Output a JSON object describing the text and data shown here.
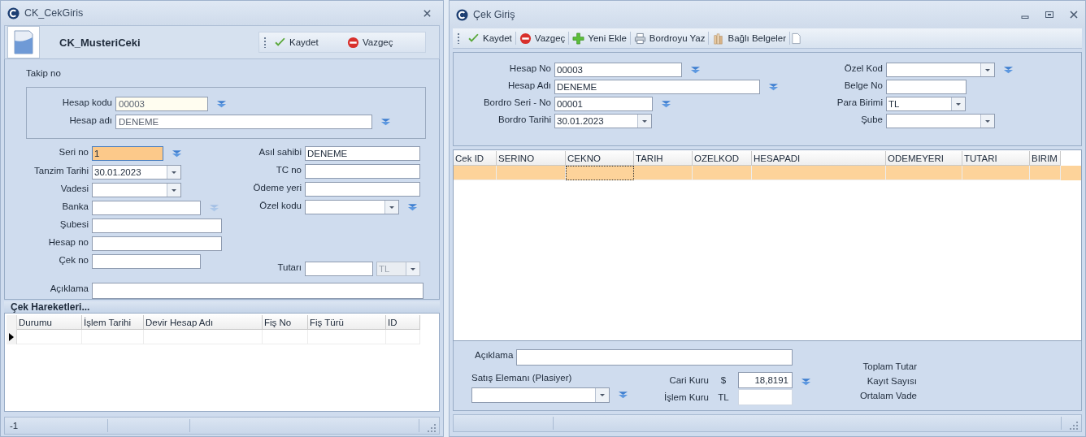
{
  "left_window": {
    "title": "CK_CekGiris",
    "header": {
      "title": "CK_MusteriCeki"
    },
    "buttons": [
      {
        "label": "Kaydet",
        "kind": "save"
      },
      {
        "label": "Vazgeç",
        "kind": "cancel"
      }
    ],
    "takip_no": {
      "label": "Takip no"
    },
    "account_fields": [
      {
        "label": "Hesap kodu",
        "value": "00003"
      },
      {
        "label": "Hesap adı",
        "value": "DENEME"
      }
    ],
    "left_fields": [
      {
        "label": "Seri no",
        "value": "1",
        "kind": "lookup",
        "focused": true,
        "lookup_disabled": false
      },
      {
        "label": "Tanzim Tarihi",
        "value": "30.01.2023",
        "kind": "combo",
        "focused": false
      },
      {
        "label": "Vadesi",
        "kind": "combo",
        "focused": false
      },
      {
        "label": "Banka",
        "kind": "lookup",
        "focused": false,
        "lookup_disabled": true
      },
      {
        "label": "Şubesi",
        "kind": "text",
        "focused": false
      },
      {
        "label": "Hesap no",
        "kind": "text",
        "focused": false
      },
      {
        "label": "Çek no",
        "kind": "text",
        "focused": false
      }
    ],
    "right_fields": [
      {
        "label": "Asıl sahibi",
        "value": "DENEME",
        "kind": "text"
      },
      {
        "label": "TC no",
        "kind": "text"
      },
      {
        "label": "Ödeme yeri",
        "kind": "text"
      },
      {
        "label": "Özel kodu",
        "kind": "combo-lookup"
      },
      {
        "label": "Tutarı",
        "kind": "amount",
        "currency": "TL"
      }
    ],
    "description": {
      "label": "Açıklama"
    },
    "movements": {
      "title": "Çek Hareketleri...",
      "columns": [
        "Durumu",
        "İşlem Tarihi",
        "Devir Hesap Adı",
        "Fiş No",
        "Fiş Türü",
        "ID"
      ],
      "rows": [
        {
          "current": true
        }
      ]
    },
    "status_bar": [
      "-1"
    ]
  },
  "right_window": {
    "title": "Çek Giriş",
    "toolbar": [
      {
        "label": "Kaydet",
        "kind": "save"
      },
      {
        "label": "Vazgeç",
        "kind": "cancel"
      },
      {
        "label": "Yeni Ekle",
        "kind": "add"
      },
      {
        "label": "Bordroyu Yaz",
        "kind": "print"
      },
      {
        "label": "Bağlı Belgeler",
        "kind": "attach"
      }
    ],
    "left_fields": [
      {
        "label": "Hesap No",
        "value": "00003",
        "kind": "lookup"
      },
      {
        "label": "Hesap Adı",
        "value": "DENEME",
        "kind": "lookup"
      },
      {
        "label": "Bordro Seri - No",
        "value": "00001",
        "kind": "lookup"
      },
      {
        "label": "Bordro Tarihi",
        "value": "30.01.2023",
        "kind": "combo"
      }
    ],
    "right_fields": [
      {
        "label": "Özel Kod",
        "kind": "combo-lookup"
      },
      {
        "label": "Belge No",
        "kind": "text"
      },
      {
        "label": "Para Birimi",
        "value": "TL",
        "kind": "combo"
      },
      {
        "label": "Şube",
        "kind": "combo"
      }
    ],
    "table": {
      "columns": [
        "Cek ID",
        "SERINO",
        "CEKNO",
        "TARIH",
        "OZELKOD",
        "HESAPADI",
        "ODEMEYERI",
        "TUTARI",
        "BIRIM"
      ],
      "rows": [
        {
          "selected": true
        }
      ]
    },
    "description": {
      "label": "Açıklama"
    },
    "sales_rep": {
      "label": "Satış Elemanı (Plasiyer)"
    },
    "rates": [
      {
        "label": "Cari Kuru",
        "currency": "$",
        "value": "18,8191"
      },
      {
        "label": "İşlem Kuru",
        "currency": "TL"
      }
    ],
    "totals": [
      "Toplam Tutar",
      "Kayıt Sayısı",
      "Ortalam Vade"
    ]
  }
}
